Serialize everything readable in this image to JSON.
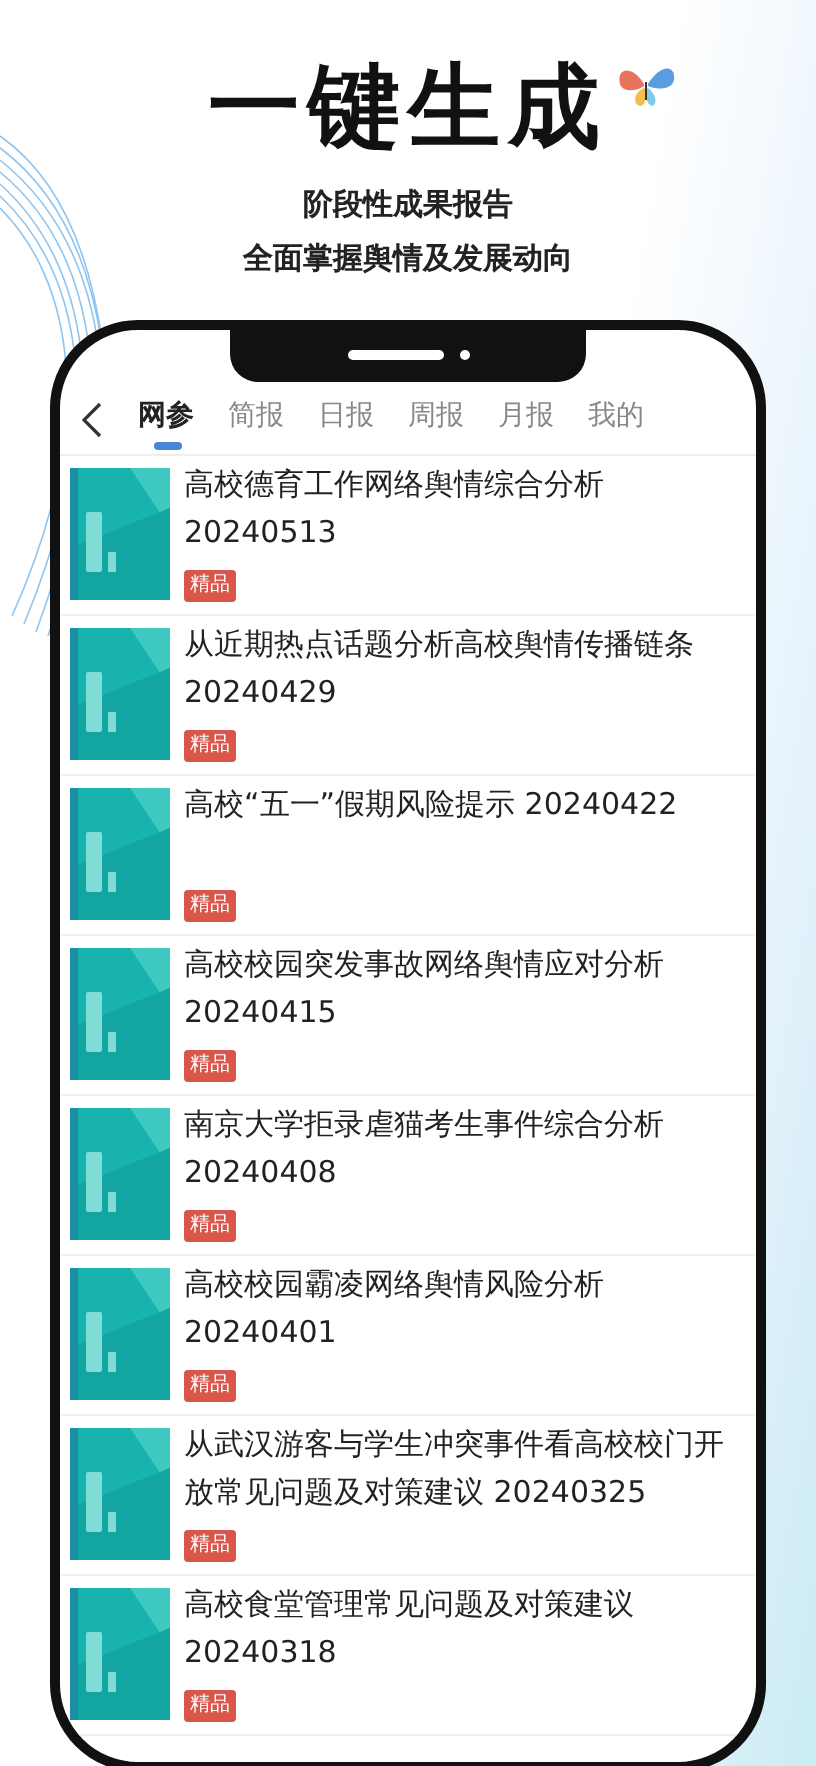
{
  "headline": "一键生成",
  "subtitle_lines": [
    "阶段性成果报告",
    "全面掌握舆情及发展动向"
  ],
  "tabs": [
    {
      "label": "网参",
      "selected": true
    },
    {
      "label": "简报",
      "selected": false
    },
    {
      "label": "日报",
      "selected": false
    },
    {
      "label": "周报",
      "selected": false
    },
    {
      "label": "月报",
      "selected": false
    },
    {
      "label": "我的",
      "selected": false
    }
  ],
  "articles": [
    {
      "title": "高校德育工作网络舆情综合分析 20240513",
      "badge": "精品"
    },
    {
      "title": "从近期热点话题分析高校舆情传播链条 20240429",
      "badge": "精品"
    },
    {
      "title": "高校“五一”假期风险提示 20240422",
      "badge": "精品"
    },
    {
      "title": "高校校园突发事故网络舆情应对分析 20240415",
      "badge": "精品"
    },
    {
      "title": "南京大学拒录虐猫考生事件综合分析 20240408",
      "badge": "精品"
    },
    {
      "title": "高校校园霸凌网络舆情风险分析 20240401",
      "badge": "精品"
    },
    {
      "title": "从武汉游客与学生冲突事件看高校校门开放常见问题及对策建议 20240325",
      "badge": "精品"
    },
    {
      "title": "高校食堂管理常见问题及对策建议 20240318",
      "badge": "精品"
    }
  ]
}
